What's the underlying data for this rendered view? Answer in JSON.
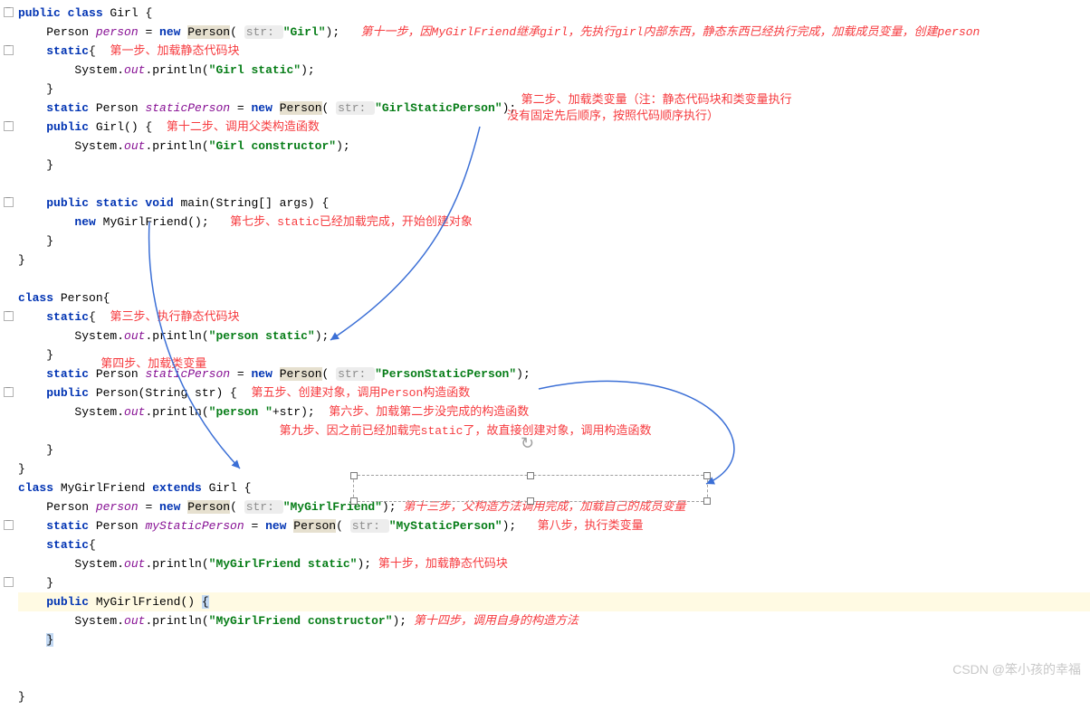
{
  "code": {
    "l1_kw1": "public class ",
    "l1_cls": "Girl ",
    "l1_brace": "{",
    "l2_indent": "    ",
    "l2_cls": "Person ",
    "l2_var": "person ",
    "l2_eq": "= ",
    "l2_kw": "new ",
    "l2_ctor": "Person",
    "l2_paren": "( ",
    "l2_hint": "str: ",
    "l2_str": "\"Girl\"",
    "l2_end": ");",
    "ann11": "   第十一步，因MyGirlFriend继承girl，先执行girl内部东西，静态东西已经执行完成，加载成员变量，创建person",
    "l3": "    ",
    "l3_kw": "static",
    "l3_brace": "{",
    "ann1": "  第一步、加载静态代码块",
    "l4": "        System.",
    "l4_out": "out",
    "l4_p": ".println(",
    "l4_str": "\"Girl static\"",
    "l4_end": ");",
    "l5": "    }",
    "l6": "    ",
    "l6_kw": "static ",
    "l6_cls": "Person ",
    "l6_var": "staticPerson ",
    "l6_eq": "= ",
    "l6_new": "new ",
    "l6_ctor": "Person",
    "l6_paren": "( ",
    "l6_hint": "str: ",
    "l6_str": "\"GirlStaticPerson\"",
    "l6_end": ");",
    "ann2a": "  第二步、加载类变量（注：静态代码块和类变量执行",
    "ann2b": "没有固定先后顺序，按照代码顺序执行）",
    "l7": "    ",
    "l7_kw": "public ",
    "l7_ctor": "Girl() {",
    "ann12": "  第十二步、调用父类构造函数",
    "l8": "        System.",
    "l8_out": "out",
    "l8_p": ".println(",
    "l8_str": "\"Girl constructor\"",
    "l8_end": ");",
    "l9": "    }",
    "l10": "",
    "l11": "    ",
    "l11_kw": "public static void ",
    "l11_m": "main(String[] args) {",
    "l12": "        ",
    "l12_kw": "new ",
    "l12_ctor": "MyGirlFriend();",
    "ann7": "   第七步、static已经加载完成，开始创建对象",
    "l13": "    }",
    "l14": "}",
    "l15": "",
    "l16_kw": "class ",
    "l16_cls": "Person{",
    "l17": "    ",
    "l17_kw": "static",
    "l17_brace": "{",
    "ann3": "  第三步、执行静态代码块",
    "l18": "        System.",
    "l18_out": "out",
    "l18_p": ".println(",
    "l18_str": "\"person static\"",
    "l18_end": ");",
    "l19": "    }",
    "ann4": "    第四步、加载类变量",
    "l20": "    ",
    "l20_kw": "static ",
    "l20_cls": "Person ",
    "l20_var": "staticPerson ",
    "l20_eq": "= ",
    "l20_new": "new ",
    "l20_ctor": "Person",
    "l20_paren": "( ",
    "l20_hint": "str: ",
    "l20_str": "\"PersonStaticPerson\"",
    "l20_end": ");",
    "l21": "    ",
    "l21_kw": "public ",
    "l21_ctor": "Person(String str) {",
    "ann5": "  第五步、创建对象，调用Person构造函数",
    "l22": "        System.",
    "l22_out": "out",
    "l22_p": ".println(",
    "l22_str": "\"person \"",
    "l22_plus": "+str);",
    "ann6": "  第六步、加载第二步没完成的构造函数",
    "ann9": "                                     第九步、因之前已经加载完static了，故直接创建对象，调用构造函数",
    "l23": "    }",
    "l24": "}",
    "l25_kw": "class ",
    "l25_cls": "MyGirlFriend ",
    "l25_ext": "extends ",
    "l25_sup": "Girl ",
    "l25_brace": "{",
    "l26": "    ",
    "l26_cls": "Person ",
    "l26_var": "person ",
    "l26_eq": "= ",
    "l26_kw": "new ",
    "l26_ctor": "Person",
    "l26_paren": "( ",
    "l26_hint": "str: ",
    "l26_str": "\"MyGirlFriend\"",
    "l26_end": ");",
    "ann13": " 第十三步，父构造方法调用完成，加载自己的成员变量",
    "l27": "    ",
    "l27_kw": "static ",
    "l27_cls": "Person ",
    "l27_var": "myStaticPerson ",
    "l27_eq": "= ",
    "l27_new": "new ",
    "l27_ctor": "Person",
    "l27_paren": "( ",
    "l27_hint": "str: ",
    "l27_str": "\"MyStaticPerson\"",
    "l27_end": ");",
    "ann8": "   第八步，执行类变量",
    "l28": "    ",
    "l28_kw": "static",
    "l28_brace": "{",
    "l29": "        System.",
    "l29_out": "out",
    "l29_p": ".println(",
    "l29_str": "\"MyGirlFriend static\"",
    "l29_end": ");",
    "ann10": " 第十步，加载静态代码块",
    "l30": "    }",
    "l31": "    ",
    "l31_kw": "public ",
    "l31_ctor": "MyGirlFriend() ",
    "l31_brace": "{",
    "l32": "        System.",
    "l32_out": "out",
    "l32_p": ".println(",
    "l32_str": "\"MyGirlFriend constructor\"",
    "l32_end": ");",
    "ann14": " 第十四步，调用自身的构造方法",
    "l33": "    ",
    "l33_brace": "}",
    "l34": "",
    "l35": "",
    "l36": "}"
  },
  "watermark": "CSDN @笨小孩的幸福"
}
